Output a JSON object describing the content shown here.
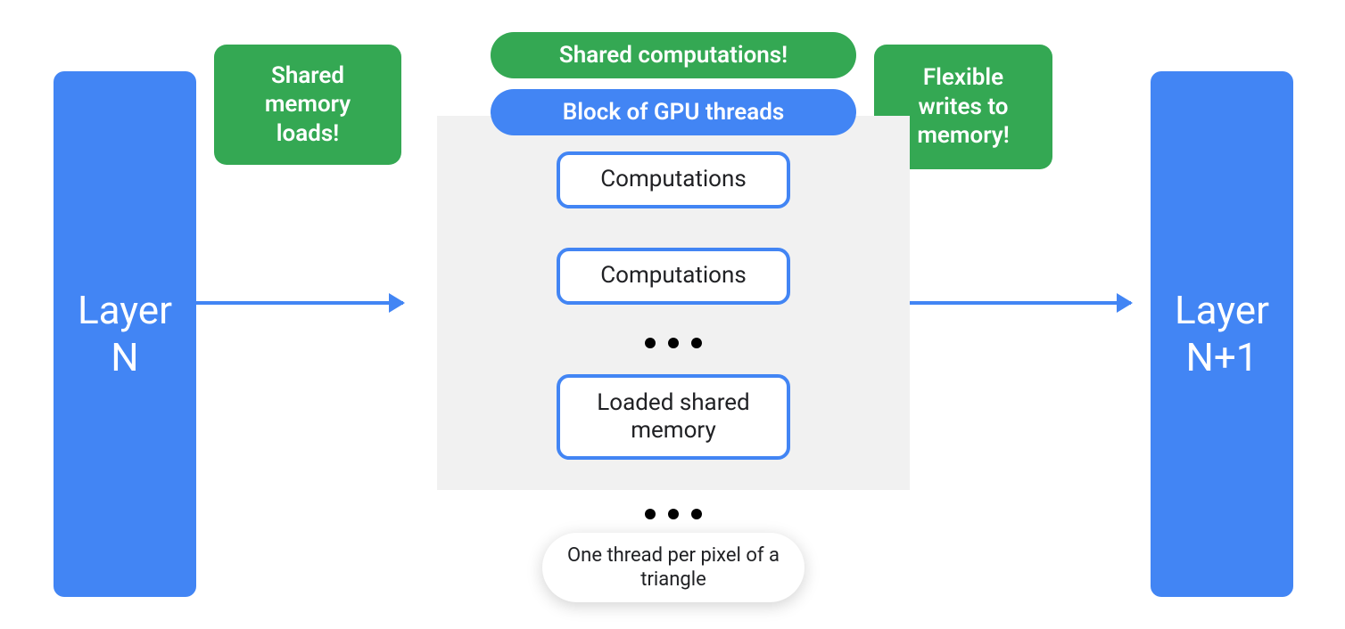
{
  "colors": {
    "blue": "#4285f4",
    "green": "#34a853",
    "gray": "#f1f1f1"
  },
  "layers": {
    "left": "Layer\nN",
    "right": "Layer\nN+1"
  },
  "callouts": {
    "loads": "Shared memory loads!",
    "shared_comp": "Shared computations!",
    "writes": "Flexible writes to memory!"
  },
  "gpu_block": {
    "header": "Block of GPU threads",
    "boxes": {
      "comp1": "Computations",
      "comp2": "Computations",
      "shared_mem": "Loaded shared memory"
    }
  },
  "caption": "One thread per pixel of a triangle"
}
